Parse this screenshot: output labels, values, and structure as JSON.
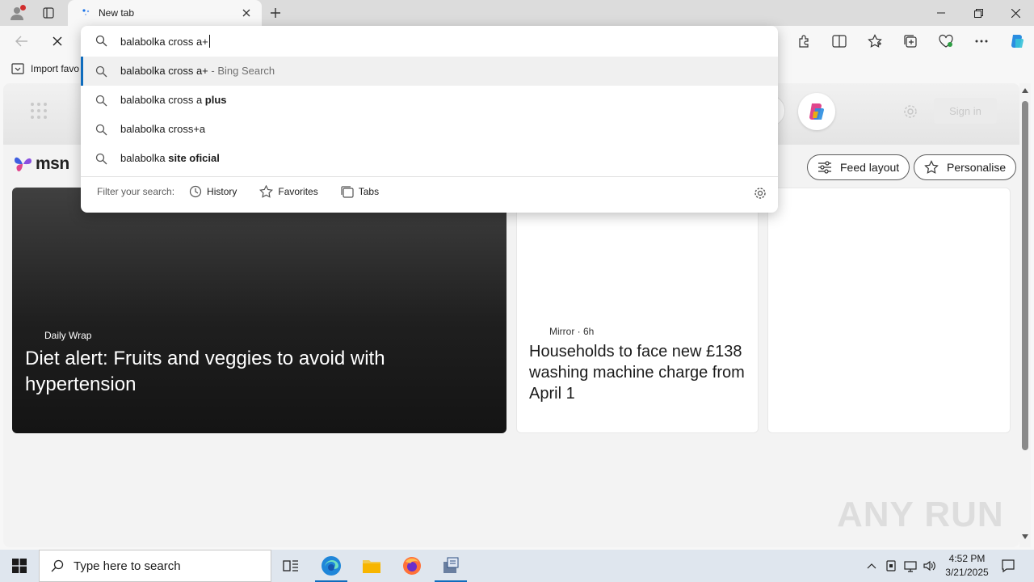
{
  "browser": {
    "tab_title": "New tab",
    "favorites_bar": {
      "import_label": "Import favo"
    }
  },
  "omnibox": {
    "query": "balabolka cross a+",
    "suggestions": [
      {
        "text": "balabolka cross a+",
        "bold": "",
        "suffix": " - Bing Search",
        "selected": true
      },
      {
        "text": "balabolka cross a ",
        "bold": "plus",
        "suffix": "",
        "selected": false
      },
      {
        "text": "balabolka cross+a",
        "bold": "",
        "suffix": "",
        "selected": false
      },
      {
        "text": "balabolka ",
        "bold": "site oficial",
        "suffix": "",
        "selected": false
      }
    ],
    "filter_label": "Filter your search:",
    "filters": [
      "History",
      "Favorites",
      "Tabs"
    ]
  },
  "msn": {
    "logo_text": "msn",
    "sign_in": "Sign in",
    "feed_layout": "Feed layout",
    "personalise": "Personalise",
    "cards": [
      {
        "source": "Daily Wrap",
        "headline": "Diet alert: Fruits and veggies to avoid with hypertension"
      },
      {
        "source": "Mirror · 6h",
        "headline": "Households to face new £138 washing machine charge from April 1"
      }
    ]
  },
  "watermark": "ANY RUN",
  "taskbar": {
    "search_placeholder": "Type here to search",
    "time": "4:52 PM",
    "date": "3/21/2025"
  },
  "colors": {
    "accent": "#0f6cbd",
    "titlebar": "#dcdcdc",
    "taskbar": "#dfe6ee"
  }
}
